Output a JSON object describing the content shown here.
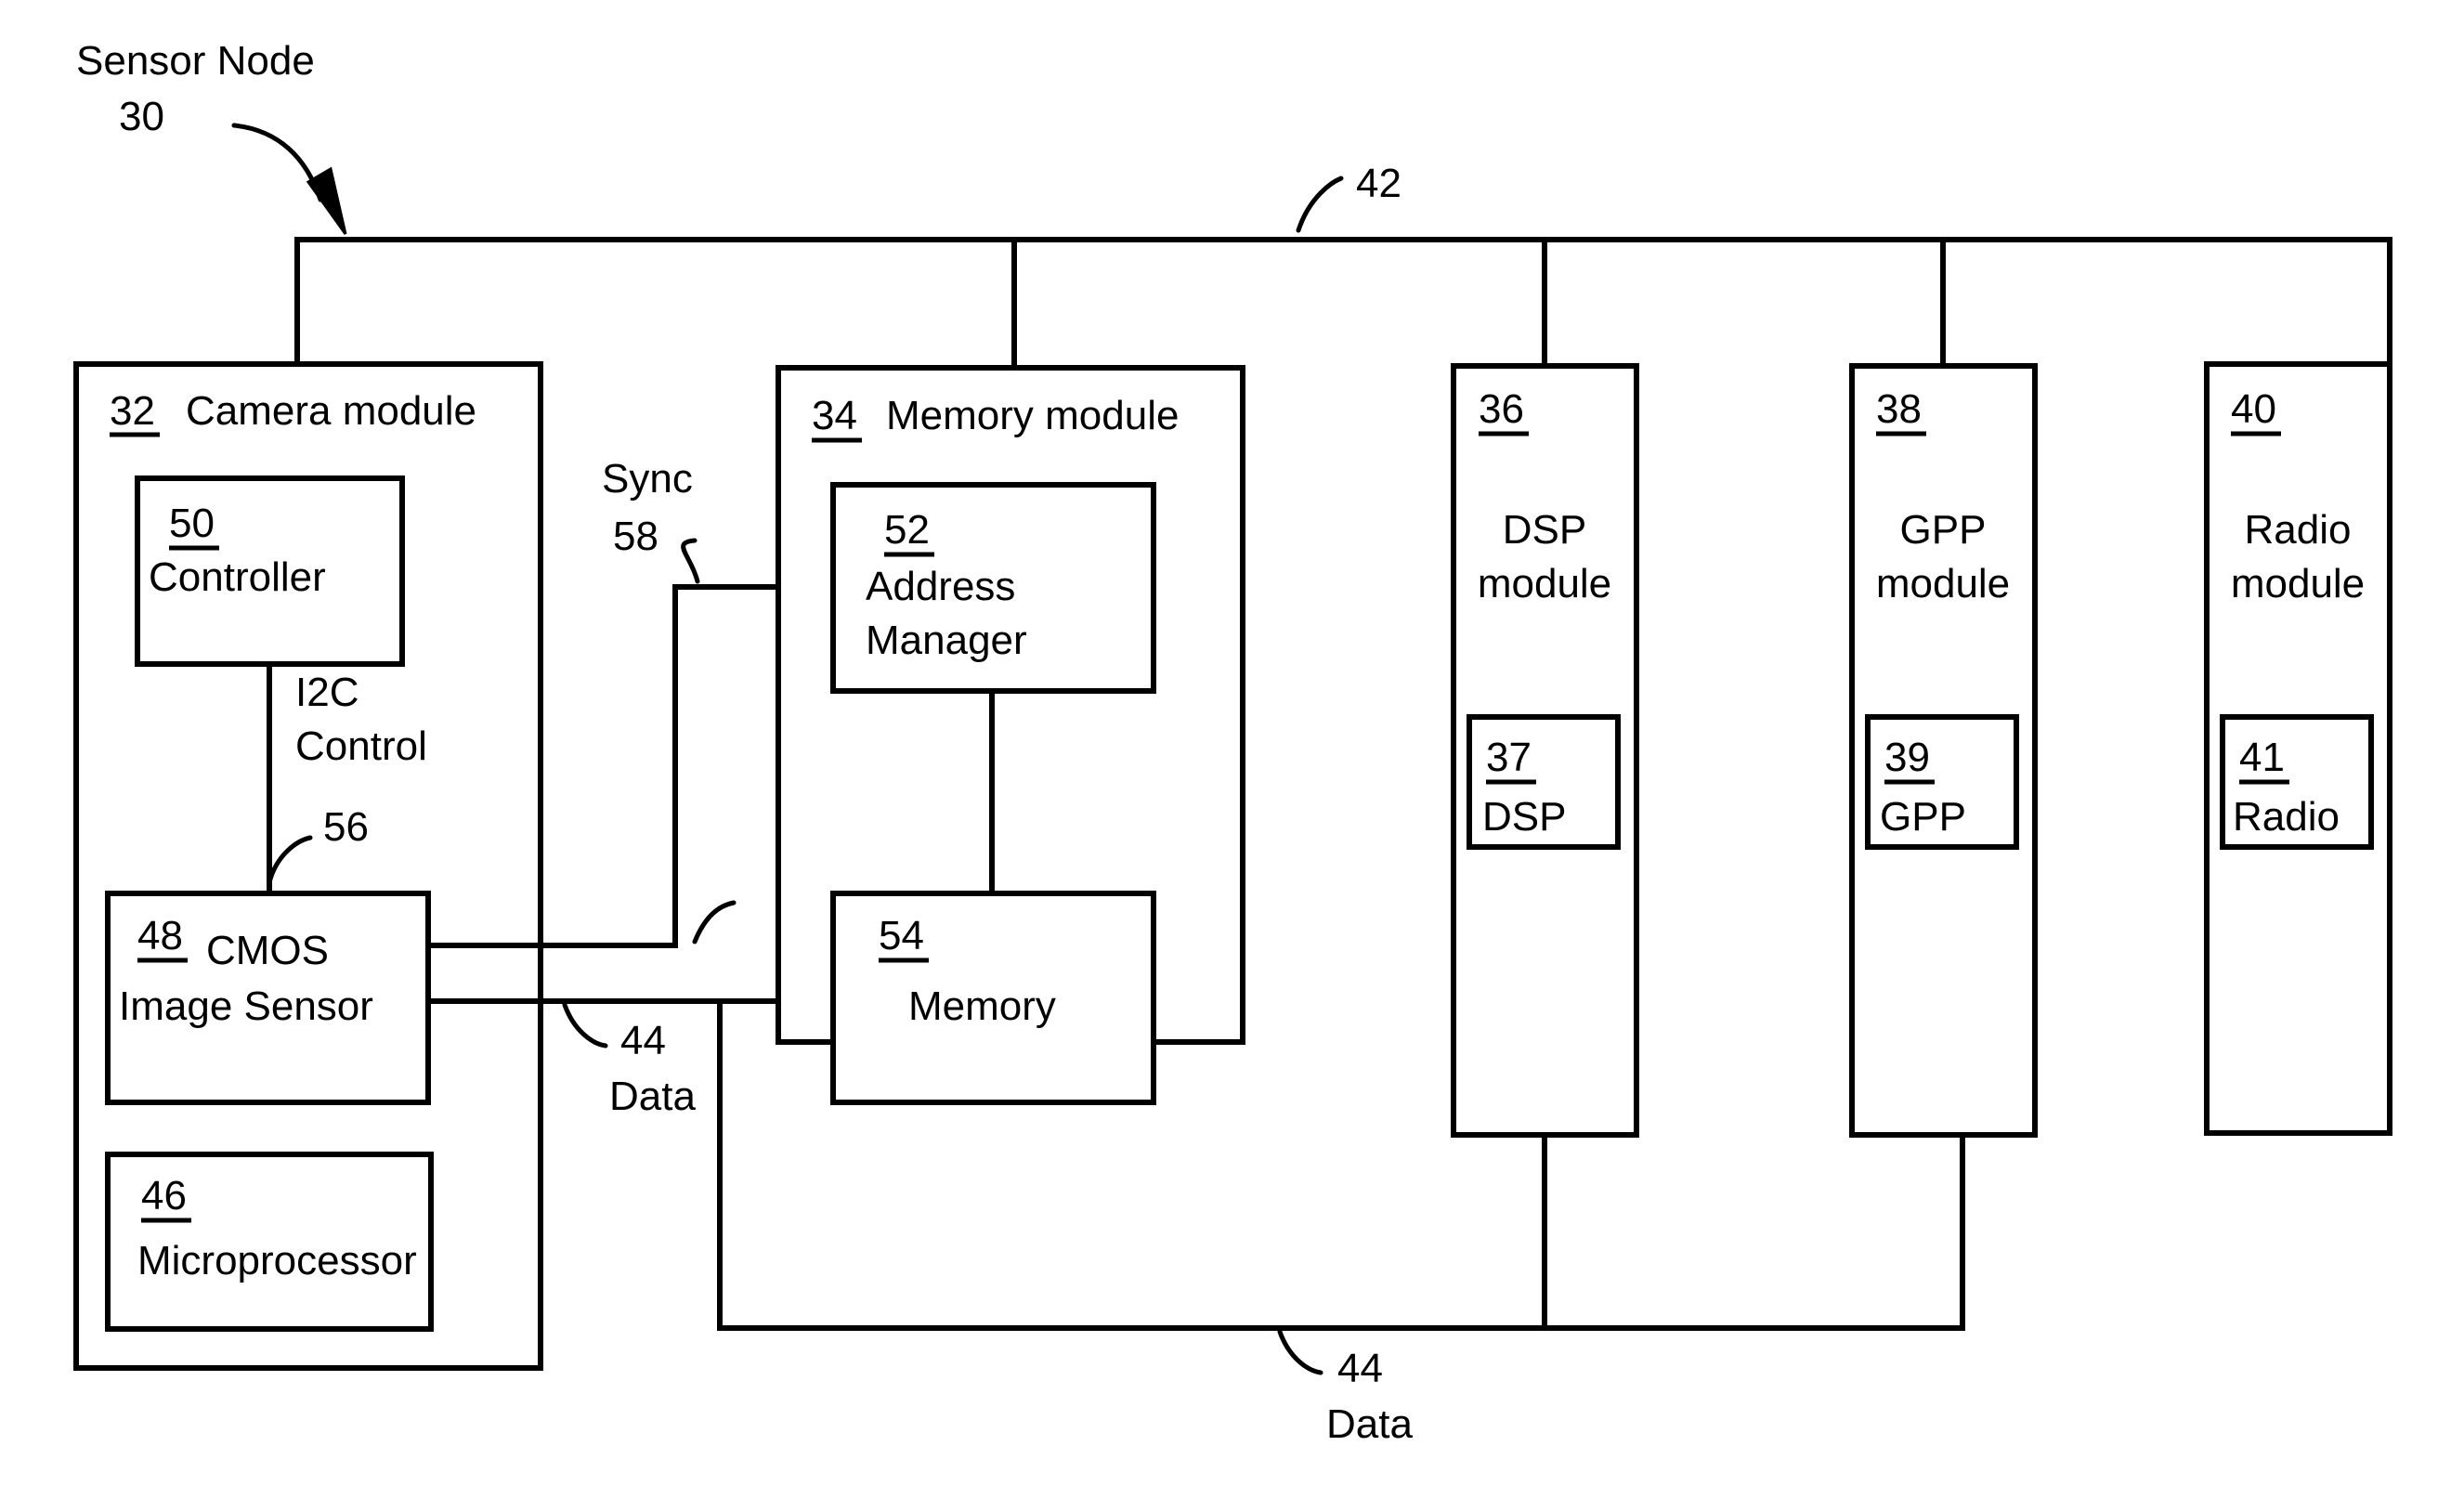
{
  "figure": {
    "title": "Sensor Node",
    "title_ref": "30",
    "type": "block-diagram"
  },
  "buses": {
    "top_bus": {
      "ref": "42",
      "label": ""
    },
    "bottom_bus": {
      "ref": "44",
      "label": "Data"
    },
    "camera_data": {
      "ref": "44",
      "label": "Data"
    },
    "sync": {
      "ref": "58",
      "label": "Sync"
    },
    "i2c": {
      "ref": "56",
      "label_line1": "I2C",
      "label_line2": "Control"
    }
  },
  "modules": [
    {
      "id": "camera",
      "ref": "32",
      "label": "Camera module",
      "children": [
        {
          "id": "controller",
          "ref": "50",
          "label": "Controller"
        },
        {
          "id": "cmos",
          "ref": "48",
          "label_line1": "CMOS",
          "label_line2": "Image Sensor"
        },
        {
          "id": "microprocessor",
          "ref": "46",
          "label": "Microprocessor"
        }
      ]
    },
    {
      "id": "memory",
      "ref": "34",
      "label": "Memory module",
      "children": [
        {
          "id": "address-manager",
          "ref": "52",
          "label_line1": "Address",
          "label_line2": "Manager"
        },
        {
          "id": "memory-block",
          "ref": "54",
          "label": "Memory"
        }
      ]
    },
    {
      "id": "dsp",
      "ref": "36",
      "label_line1": "DSP",
      "label_line2": "module",
      "children": [
        {
          "id": "dsp-core",
          "ref": "37",
          "label": "DSP"
        }
      ]
    },
    {
      "id": "gpp",
      "ref": "38",
      "label_line1": "GPP",
      "label_line2": "module",
      "children": [
        {
          "id": "gpp-core",
          "ref": "39",
          "label": "GPP"
        }
      ]
    },
    {
      "id": "radio",
      "ref": "40",
      "label_line1": "Radio",
      "label_line2": "module",
      "children": [
        {
          "id": "radio-core",
          "ref": "41",
          "label": "Radio"
        }
      ]
    }
  ],
  "colors": {
    "ink": "#000000",
    "paper": "#ffffff"
  }
}
